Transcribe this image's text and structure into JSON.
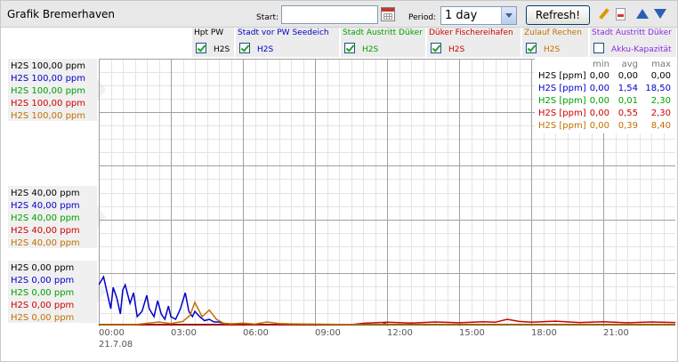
{
  "app": {
    "title": "Grafik Bremerhaven"
  },
  "toolbar": {
    "start_label": "Start:",
    "start_value": "",
    "period_label": "Period:",
    "period_value": "1 day",
    "refresh_label": "Refresh!"
  },
  "channels": [
    {
      "title": "Hpt PW",
      "sub": "H2S",
      "checked": true,
      "color": "#000000"
    },
    {
      "title": "Stadt vor PW Seedeich",
      "sub": "H2S",
      "checked": true,
      "color": "#0000c8"
    },
    {
      "title": "Stadt Austritt Düker",
      "sub": "H2S",
      "checked": true,
      "color": "#00a000"
    },
    {
      "title": "Düker Fischereihafen",
      "sub": "H2S",
      "checked": true,
      "color": "#d00000"
    },
    {
      "title": "Zulauf Rechen",
      "sub": "H2S",
      "checked": true,
      "color": "#c07000"
    },
    {
      "title": "Stadt Austritt Düker",
      "sub": "Akku-Kapazität",
      "checked": false,
      "color": "#8a2be2"
    }
  ],
  "y_groups": [
    [
      "H2S 100,00 ppm",
      "H2S 100,00 ppm",
      "H2S 100,00 ppm",
      "H2S 100,00 ppm",
      "H2S 100,00 ppm"
    ],
    [
      "H2S 40,00 ppm",
      "H2S 40,00 ppm",
      "H2S 40,00 ppm",
      "H2S 40,00 ppm",
      "H2S 40,00 ppm"
    ],
    [
      "H2S  0,00 ppm",
      "H2S  0,00 ppm",
      "H2S 0,00 ppm",
      "H2S  0,00 ppm",
      "H2S  0,00 ppm"
    ]
  ],
  "stats": {
    "headers": [
      "min",
      "avg",
      "max"
    ],
    "rows": [
      {
        "label": "H2S [ppm]",
        "min": "0,00",
        "avg": "0,00",
        "max": "0,00"
      },
      {
        "label": "H2S [ppm]",
        "min": "0,00",
        "avg": "1,54",
        "max": "18,50"
      },
      {
        "label": "H2S [ppm]",
        "min": "0,00",
        "avg": "0,01",
        "max": "2,30"
      },
      {
        "label": "H2S [ppm]",
        "min": "0,00",
        "avg": "0,55",
        "max": "2,30"
      },
      {
        "label": "H2S [ppm]",
        "min": "0,00",
        "avg": "0,39",
        "max": "8,40"
      }
    ]
  },
  "x_ticks": [
    "00:00",
    "03:00",
    "06:00",
    "09:00",
    "12:00",
    "15:00",
    "18:00",
    "21:00"
  ],
  "date_label": "21.7.08",
  "chart_data": {
    "type": "line",
    "xlabel": "",
    "ylabel": "",
    "x_range_hours": [
      0,
      24
    ],
    "ylim": [
      0,
      100
    ],
    "grid": true,
    "series": [
      {
        "color": "#000000",
        "x": [
          0,
          24
        ],
        "y": [
          0,
          0
        ]
      },
      {
        "color": "#0000c8",
        "x": [
          0,
          0.2,
          0.35,
          0.5,
          0.6,
          0.75,
          0.9,
          1.0,
          1.1,
          1.3,
          1.45,
          1.6,
          1.8,
          2.0,
          2.1,
          2.3,
          2.45,
          2.6,
          2.75,
          2.9,
          3.0,
          3.2,
          3.4,
          3.6,
          3.75,
          3.9,
          4.0,
          4.2,
          4.4,
          4.6,
          4.8,
          5.0,
          5.2,
          5.5,
          6.0,
          24
        ],
        "y": [
          15,
          18,
          12,
          6,
          14,
          10,
          4,
          13,
          15,
          8,
          12,
          3,
          5,
          11,
          6,
          3,
          9,
          4,
          2,
          7,
          3,
          2,
          6,
          12,
          5,
          3,
          5,
          3,
          1.5,
          2,
          1,
          1,
          0.5,
          0.3,
          0,
          0
        ]
      },
      {
        "color": "#00a000",
        "x": [
          0,
          11.8,
          11.9,
          12.0,
          24
        ],
        "y": [
          0,
          0,
          0.6,
          0,
          0
        ]
      },
      {
        "color": "#d00000",
        "x": [
          0,
          10.5,
          11.0,
          12.0,
          13.0,
          14.0,
          15.0,
          16.0,
          16.5,
          17.0,
          17.5,
          18.0,
          19.0,
          20.0,
          21.0,
          22.0,
          23.0,
          24.0
        ],
        "y": [
          0,
          0,
          0.5,
          0.9,
          0.6,
          1.0,
          0.7,
          1.1,
          0.9,
          2.0,
          1.2,
          0.9,
          1.3,
          0.8,
          1.1,
          0.7,
          1.0,
          0.8
        ]
      },
      {
        "color": "#c07000",
        "x": [
          0,
          1.5,
          2.0,
          2.5,
          3.0,
          3.5,
          3.8,
          4.0,
          4.3,
          4.6,
          4.9,
          5.2,
          5.5,
          6.0,
          6.5,
          7.0,
          7.5,
          8.0,
          9.0,
          10.0,
          12.0,
          24
        ],
        "y": [
          0,
          0,
          0.5,
          1,
          0.4,
          1.2,
          3.5,
          8.4,
          3,
          5.5,
          2,
          0.5,
          0.3,
          0.6,
          0.2,
          1.0,
          0.4,
          0.3,
          0.2,
          0.1,
          0,
          0
        ]
      }
    ]
  }
}
